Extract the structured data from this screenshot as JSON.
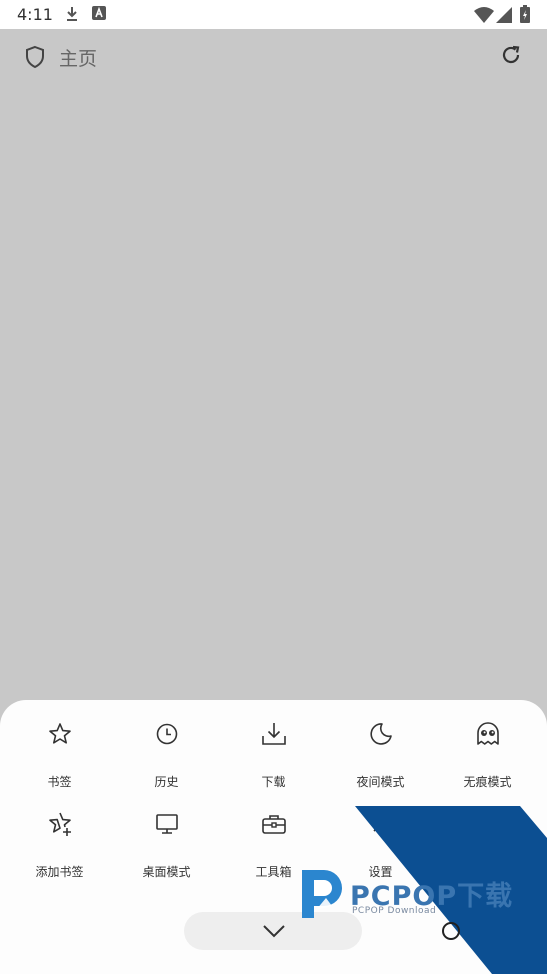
{
  "status_bar": {
    "time": "4:11",
    "left_icons": [
      "download-icon",
      "font-a-icon"
    ],
    "right_icons": [
      "wifi-icon",
      "signal-icon",
      "battery-charging-icon"
    ]
  },
  "browser": {
    "title": "主页",
    "left_icon": "shield-icon",
    "right_icon": "reload-icon"
  },
  "menu": {
    "items": [
      {
        "label": "书签",
        "icon": "star-icon"
      },
      {
        "label": "历史",
        "icon": "clock-icon"
      },
      {
        "label": "下载",
        "icon": "download-icon"
      },
      {
        "label": "夜间模式",
        "icon": "moon-icon"
      },
      {
        "label": "无痕模式",
        "icon": "ghost-icon"
      },
      {
        "label": "添加书签",
        "icon": "star-add-icon"
      },
      {
        "label": "桌面模式",
        "icon": "monitor-icon"
      },
      {
        "label": "工具箱",
        "icon": "toolbox-icon"
      },
      {
        "label": "设置",
        "icon": "settings-icon"
      }
    ],
    "page_indicator_count": 2,
    "collapse_icon": "chevron-down-icon"
  },
  "watermark": {
    "brand": "PCPOP下载",
    "sub": "PCPOP Download",
    "colors": {
      "band": "#0c4f92",
      "text": "#3a75b0"
    }
  }
}
